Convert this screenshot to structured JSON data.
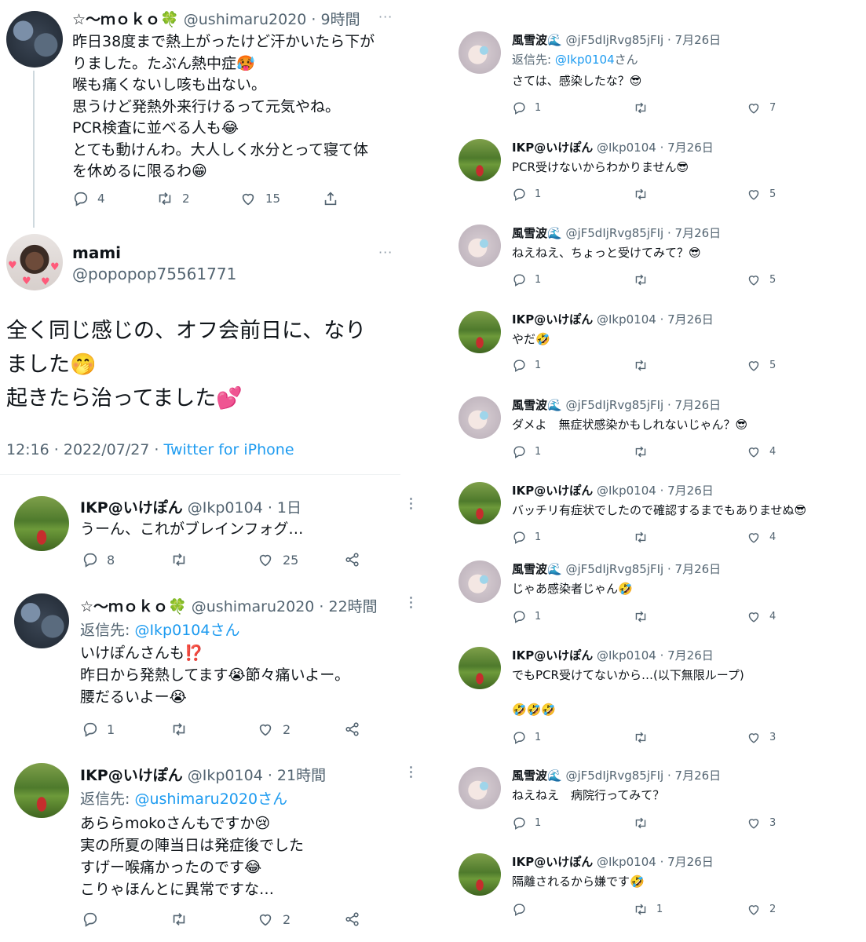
{
  "left": {
    "main_thread": {
      "parent": {
        "name": "☆〜ｍｏｋｏ🍀",
        "handle": "@ushimaru2020",
        "time": "· 9時間",
        "text": "昨日38度まで熱上がったけど汗かいたら下が\nりました。たぶん熱中症🥵\n喉も痛くないし咳も出ない。\n思うけど発熱外来行けるって元気やね。\nPCR検査に並べる人も😂\nとても動けんわ。大人しく水分とって寝て体\nを休めるに限るわ😁",
        "replies": "4",
        "retweets": "2",
        "likes": "15"
      },
      "main": {
        "name": "mami",
        "handle": "@popopop75561771",
        "text": "全く同じ感じの、オフ会前日に、なり\nました🤭\n起きたら治ってました💕",
        "timestamp": "12:16 · 2022/07/27 · ",
        "source": "Twitter for iPhone"
      }
    },
    "replies": [
      {
        "name": "IKP@いけぽん",
        "handle": "@Ikp0104",
        "time": "· 1日",
        "reply_to": "",
        "text": "うーん、これがブレインフォグ…",
        "replies": "8",
        "likes": "25"
      },
      {
        "name": "☆〜ｍｏｋｏ🍀",
        "handle": "@ushimaru2020",
        "time": "· 22時間",
        "reply_to_prefix": "返信先: ",
        "reply_to": "@Ikp0104さん",
        "text": "いけぽんさんも⁉️\n昨日から発熱してます😭節々痛いよー。\n腰だるいよー😭",
        "replies": "1",
        "likes": "2"
      },
      {
        "name": "IKP@いけぽん",
        "handle": "@Ikp0104",
        "time": "· 21時間",
        "reply_to_prefix": "返信先: ",
        "reply_to": "@ushimaru2020さん",
        "text": "あららmokoさんもですか😢\n実の所夏の陣当日は発症後でした\nすげー喉痛かったのです😂\nこりゃほんとに異常ですな…",
        "replies": "",
        "likes": "2"
      }
    ]
  },
  "right": {
    "tweets": [
      {
        "name": "風雪波🌊",
        "handle": "@jF5dIjRvg85jFIj",
        "time": "· 7月26日",
        "reply_to_prefix": "返信先: ",
        "reply_to": "@Ikp0104",
        "reply_to_suffix": "さん",
        "text": "さては、感染したな？😎",
        "replies": "1",
        "retweets": "",
        "likes": "7",
        "avatar": "kaze"
      },
      {
        "name": "IKP@いけぽん",
        "handle": "@Ikp0104",
        "time": "· 7月26日",
        "text": "PCR受けないからわかりません😎",
        "replies": "1",
        "retweets": "",
        "likes": "5",
        "avatar": "ikp"
      },
      {
        "name": "風雪波🌊",
        "handle": "@jF5dIjRvg85jFIj",
        "time": "· 7月26日",
        "text": "ねえねえ、ちょっと受けてみて？😎",
        "replies": "1",
        "retweets": "",
        "likes": "5",
        "avatar": "kaze"
      },
      {
        "name": "IKP@いけぽん",
        "handle": "@Ikp0104",
        "time": "· 7月26日",
        "text": "やだ🤣",
        "replies": "1",
        "retweets": "",
        "likes": "5",
        "avatar": "ikp"
      },
      {
        "name": "風雪波🌊",
        "handle": "@jF5dIjRvg85jFIj",
        "time": "· 7月26日",
        "text": "ダメよ　無症状感染かもしれないじゃん？😎",
        "replies": "1",
        "retweets": "",
        "likes": "4",
        "avatar": "kaze"
      },
      {
        "name": "IKP@いけぽん",
        "handle": "@Ikp0104",
        "time": "· 7月26日",
        "text": "バッチリ有症状でしたので確認するまでもありませぬ😎",
        "replies": "1",
        "retweets": "",
        "likes": "4",
        "avatar": "ikp"
      },
      {
        "name": "風雪波🌊",
        "handle": "@jF5dIjRvg85jFIj",
        "time": "· 7月26日",
        "text": "じゃあ感染者じゃん🤣",
        "replies": "1",
        "retweets": "",
        "likes": "4",
        "avatar": "kaze"
      },
      {
        "name": "IKP@いけぽん",
        "handle": "@Ikp0104",
        "time": "· 7月26日",
        "text": "でもPCR受けてないから…(以下無限ループ)\n\n🤣🤣🤣",
        "replies": "1",
        "retweets": "",
        "likes": "3",
        "avatar": "ikp"
      },
      {
        "name": "風雪波🌊",
        "handle": "@jF5dIjRvg85jFIj",
        "time": "· 7月26日",
        "text": "ねえねえ　病院行ってみて？",
        "replies": "1",
        "retweets": "",
        "likes": "3",
        "avatar": "kaze"
      },
      {
        "name": "IKP@いけぽん",
        "handle": "@Ikp0104",
        "time": "· 7月26日",
        "text": "隔離されるから嫌です🤣",
        "replies": "",
        "retweets": "1",
        "likes": "2",
        "avatar": "ikp"
      }
    ]
  }
}
